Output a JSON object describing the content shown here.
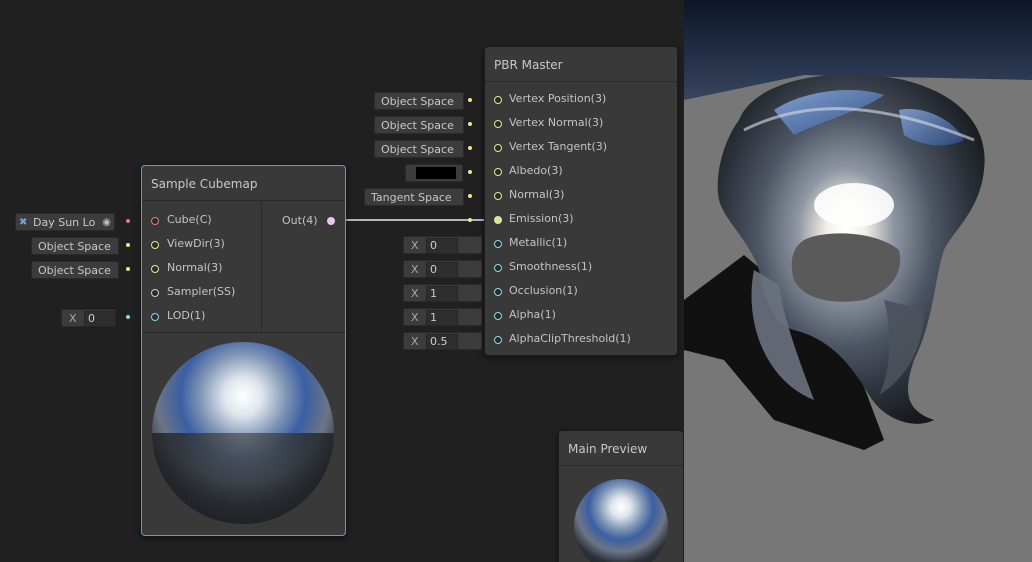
{
  "pbr_master": {
    "title": "PBR Master",
    "inputs": [
      {
        "label": "Vertex Position(3)",
        "field": "Object Space"
      },
      {
        "label": "Vertex Normal(3)",
        "field": "Object Space"
      },
      {
        "label": "Vertex Tangent(3)",
        "field": "Object Space"
      },
      {
        "label": "Albedo(3)",
        "field": ""
      },
      {
        "label": "Normal(3)",
        "field": "Tangent Space"
      },
      {
        "label": "Emission(3)",
        "field": ""
      },
      {
        "label": "Metallic(1)",
        "x_label": "X",
        "value": "0"
      },
      {
        "label": "Smoothness(1)",
        "x_label": "X",
        "value": "0"
      },
      {
        "label": "Occlusion(1)",
        "x_label": "X",
        "value": "1"
      },
      {
        "label": "Alpha(1)",
        "x_label": "X",
        "value": "1"
      },
      {
        "label": "AlphaClipThreshold(1)",
        "x_label": "X",
        "value": "0.5"
      }
    ],
    "albedo_color": "#000000"
  },
  "sample_cubemap": {
    "title": "Sample Cubemap",
    "inputs": [
      {
        "label": "Cube(C)",
        "field": "Day Sun Lo"
      },
      {
        "label": "ViewDir(3)",
        "field": "Object Space"
      },
      {
        "label": "Normal(3)",
        "field": "Object Space"
      },
      {
        "label": "Sampler(SS)",
        "field": ""
      },
      {
        "label": "LOD(1)",
        "x_label": "X",
        "value": "0"
      }
    ],
    "output": "Out(4)"
  },
  "main_preview": {
    "title": "Main Preview"
  },
  "colors": {
    "vector3": "#e8e890",
    "vector1": "#88d8e8",
    "cubemap": "#e87878",
    "edge": "#f0d8f0",
    "selection": "#44a6e0"
  }
}
